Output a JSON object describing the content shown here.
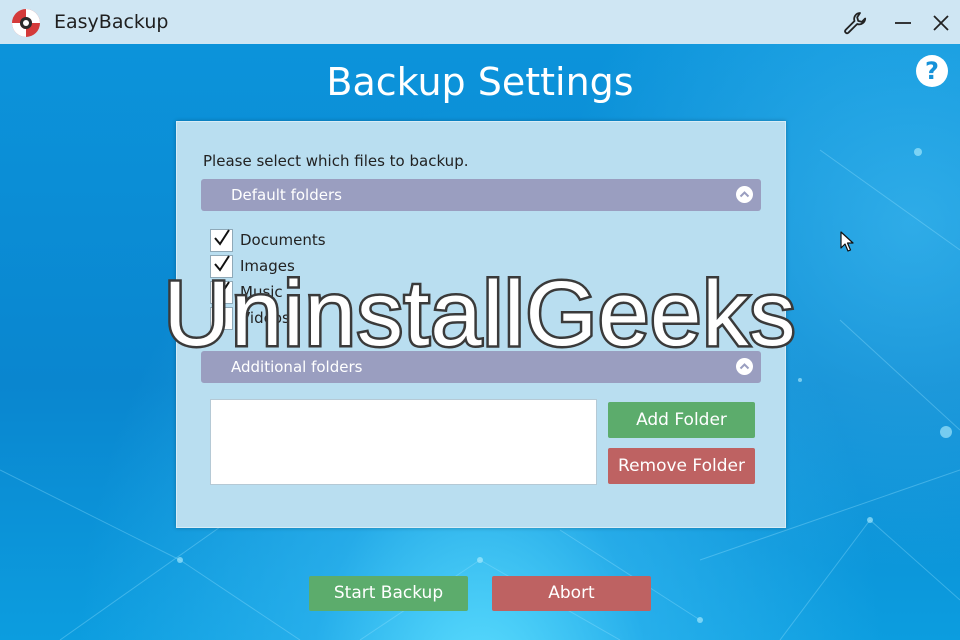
{
  "window": {
    "title": "EasyBackup",
    "logo_icon": "lifebuoy-icon",
    "controls": [
      "wrench-icon",
      "minimize-icon",
      "close-icon"
    ]
  },
  "help": {
    "label": "?"
  },
  "page": {
    "title": "Backup Settings"
  },
  "panel": {
    "instruction": "Please select which files to backup.",
    "default_section": {
      "label": "Default folders",
      "items": [
        {
          "label": "Documents",
          "checked": true
        },
        {
          "label": "Images",
          "checked": true
        },
        {
          "label": "Music",
          "checked": true
        },
        {
          "label": "Videos",
          "checked": false
        }
      ]
    },
    "additional_section": {
      "label": "Additional folders"
    },
    "add_folder": "Add Folder",
    "remove_folder": "Remove Folder"
  },
  "footer": {
    "start_backup": "Start Backup",
    "abort": "Abort"
  },
  "watermark": "UninstallGeeks",
  "colors": {
    "background": "#0a8fd6",
    "titlebar": "#cfe6f3",
    "panel": "#b9def0",
    "section_header": "#9a9ec0",
    "green_button": "#5cac6c",
    "red_button": "#be6262"
  }
}
